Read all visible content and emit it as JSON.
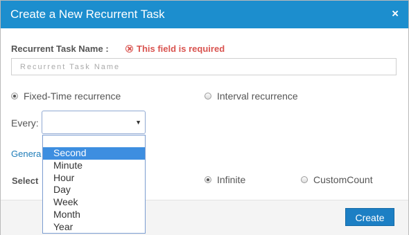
{
  "dialog": {
    "title": "Create a New Recurrent Task",
    "close_glyph": "×"
  },
  "task_name": {
    "label": "Recurrent Task Name :",
    "error": "This field is required",
    "placeholder": "Recurrent Task Name",
    "value": ""
  },
  "recurrence": {
    "fixed_label": "Fixed-Time recurrence",
    "fixed_checked": true,
    "interval_label": "Interval recurrence",
    "interval_checked": false
  },
  "every": {
    "label": "Every:",
    "selected_value": "",
    "options": [
      "Second",
      "Minute",
      "Hour",
      "Day",
      "Week",
      "Month",
      "Year"
    ],
    "highlighted_index": 0
  },
  "partial_link": "Genera",
  "count": {
    "label_partial": "Select",
    "infinite_label": "Infinite",
    "infinite_checked": true,
    "custom_label": "CustomCount",
    "custom_checked": false
  },
  "footer": {
    "create_label": "Create"
  },
  "colors": {
    "title_bar": "#1c8ece",
    "error": "#d9534f",
    "create_button": "#1c7fc4",
    "highlight": "#3d8ee0",
    "link": "#1e7cb8"
  },
  "icons": {
    "close": "close-icon",
    "error": "error-circle-icon",
    "caret": "chevron-down-icon"
  }
}
